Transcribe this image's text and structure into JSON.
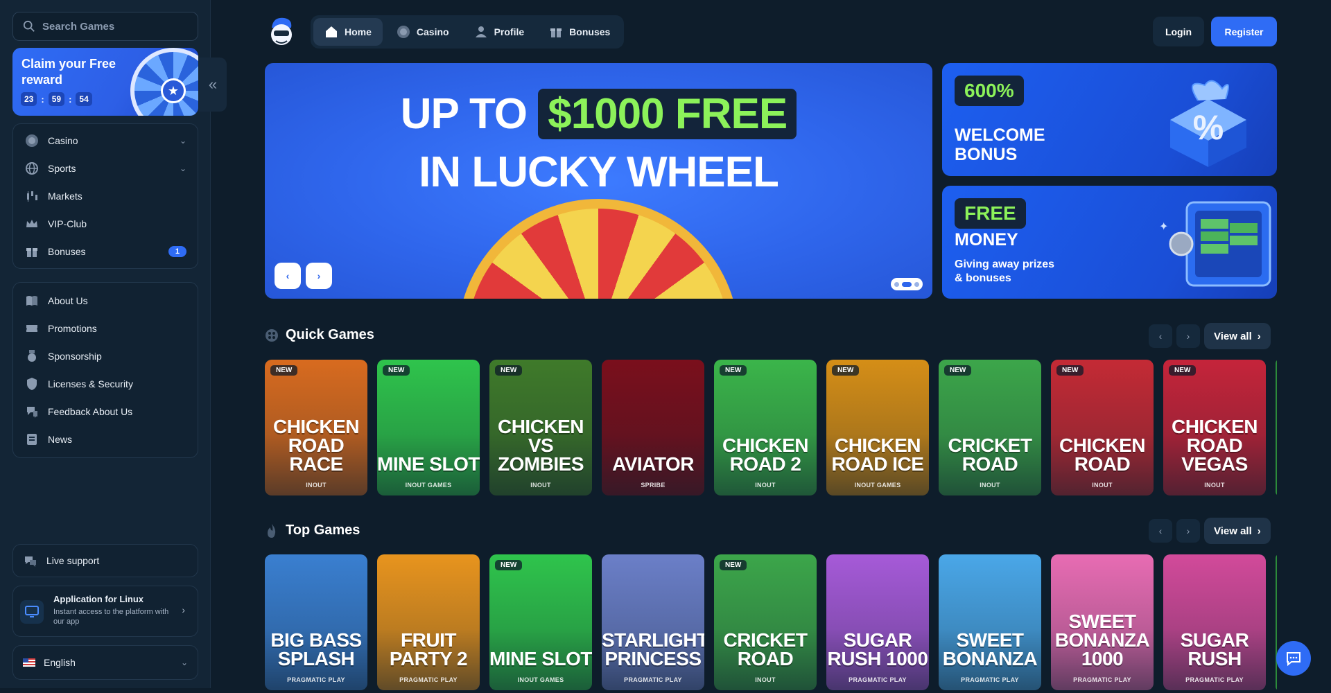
{
  "search": {
    "placeholder": "Search Games"
  },
  "promo": {
    "title": "Claim your Free reward",
    "timer": [
      "23",
      "59",
      "54"
    ]
  },
  "nav_main": [
    {
      "label": "Casino",
      "icon": "casino-chip-icon",
      "chevron": true
    },
    {
      "label": "Sports",
      "icon": "globe-icon",
      "chevron": true
    },
    {
      "label": "Markets",
      "icon": "candles-icon"
    },
    {
      "label": "VIP-Club",
      "icon": "crown-icon"
    },
    {
      "label": "Bonuses",
      "icon": "gift-icon",
      "badge": "1"
    }
  ],
  "nav_info": [
    {
      "label": "About Us",
      "icon": "book-icon"
    },
    {
      "label": "Promotions",
      "icon": "ticket-icon"
    },
    {
      "label": "Sponsorship",
      "icon": "medal-icon"
    },
    {
      "label": "Licenses & Security",
      "icon": "shield-icon"
    },
    {
      "label": "Feedback About Us",
      "icon": "thumb-icon"
    },
    {
      "label": "News",
      "icon": "news-icon"
    }
  ],
  "live_support": "Live support",
  "app": {
    "title": "Application for Linux",
    "subtitle": "Instant access to the platform with our app"
  },
  "language": "English",
  "tabs": [
    {
      "label": "Home",
      "icon": "home-icon",
      "active": true
    },
    {
      "label": "Casino",
      "icon": "casino-chip-icon"
    },
    {
      "label": "Profile",
      "icon": "user-icon"
    },
    {
      "label": "Bonuses",
      "icon": "gift-icon"
    }
  ],
  "auth": {
    "login": "Login",
    "register": "Register"
  },
  "hero": {
    "line1_prefix": "UP TO",
    "line1_highlight": "$1000 FREE",
    "line2": "IN LUCKY WHEEL"
  },
  "cards": [
    {
      "pill": "600%",
      "title": "WELCOME BONUS"
    },
    {
      "pill": "FREE",
      "title": "MONEY",
      "subtitle": "Giving away prizes & bonuses"
    }
  ],
  "sections": {
    "quick": "Quick Games",
    "top": "Top Games",
    "view_all": "View all"
  },
  "quick_games": [
    {
      "name": "CHICKEN ROAD RACE",
      "provider": "INOUT",
      "new": true,
      "color": "#d86b1f"
    },
    {
      "name": "MINE SLOT",
      "provider": "INOUT GAMES",
      "new": true,
      "color": "#2fc44c"
    },
    {
      "name": "CHICKEN VS ZOMBIES",
      "provider": "INOUT",
      "new": true,
      "color": "#3f7a2a"
    },
    {
      "name": "AVIATOR",
      "provider": "SPRIBE",
      "new": false,
      "color": "#7a0f1c"
    },
    {
      "name": "CHICKEN ROAD 2",
      "provider": "INOUT",
      "new": true,
      "color": "#3bb54a"
    },
    {
      "name": "CHICKEN ROAD ICE",
      "provider": "INOUT GAMES",
      "new": true,
      "color": "#d58e17"
    },
    {
      "name": "CRICKET ROAD",
      "provider": "INOUT",
      "new": true,
      "color": "#3ca64a"
    },
    {
      "name": "CHICKEN ROAD",
      "provider": "INOUT",
      "new": true,
      "color": "#c42a35"
    },
    {
      "name": "CHICKEN ROAD VEGAS",
      "provider": "INOUT",
      "new": true,
      "color": "#c5243a"
    }
  ],
  "top_games": [
    {
      "name": "BIG BASS SPLASH",
      "provider": "PRAGMATIC PLAY",
      "new": false,
      "color": "#3a7fd0"
    },
    {
      "name": "FRUIT PARTY 2",
      "provider": "PRAGMATIC PLAY",
      "new": false,
      "color": "#e8941e"
    },
    {
      "name": "MINE SLOT",
      "provider": "INOUT GAMES",
      "new": true,
      "color": "#2fc44c"
    },
    {
      "name": "STARLIGHT PRINCESS",
      "provider": "PRAGMATIC PLAY",
      "new": false,
      "color": "#6b7fc8"
    },
    {
      "name": "CRICKET ROAD",
      "provider": "INOUT",
      "new": true,
      "color": "#3ca64a"
    },
    {
      "name": "SUGAR RUSH 1000",
      "provider": "PRAGMATIC PLAY",
      "new": false,
      "color": "#a65ad8"
    },
    {
      "name": "SWEET BONANZA",
      "provider": "PRAGMATIC PLAY",
      "new": false,
      "color": "#4aa7e8"
    },
    {
      "name": "SWEET BONANZA 1000",
      "provider": "PRAGMATIC PLAY",
      "new": false,
      "color": "#e86cb3"
    },
    {
      "name": "SUGAR RUSH",
      "provider": "PRAGMATIC PLAY",
      "new": false,
      "color": "#d24a9a"
    }
  ]
}
